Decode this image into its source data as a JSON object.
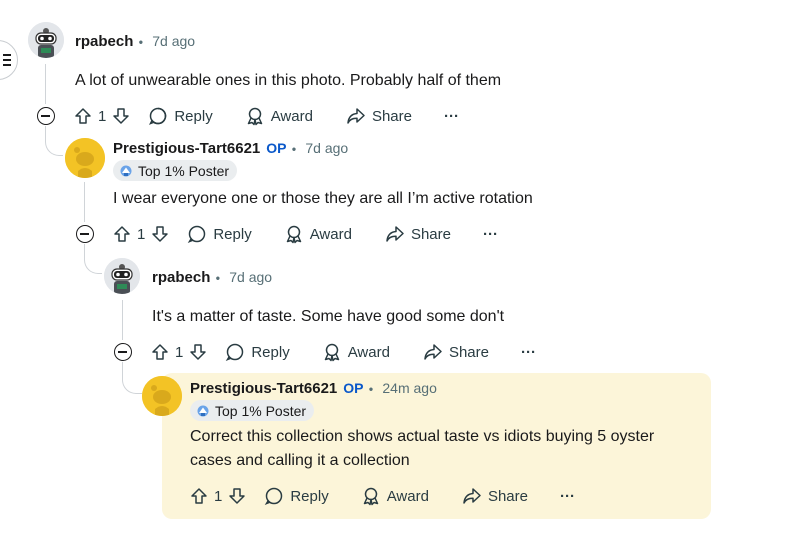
{
  "comments": [
    {
      "username": "rpabech",
      "time": "7d ago",
      "text": "A lot of unwearable ones in this photo. Probably half of them",
      "votes": "1",
      "reply": "Reply",
      "award": "Award",
      "share": "Share",
      "more": "···"
    },
    {
      "username": "Prestigious-Tart6621",
      "op": "OP",
      "time": "7d ago",
      "flair": "Top 1% Poster",
      "text": "I wear everyone one or those they are all I’m active rotation",
      "votes": "1",
      "reply": "Reply",
      "award": "Award",
      "share": "Share",
      "more": "···"
    },
    {
      "username": "rpabech",
      "time": "7d ago",
      "text": "It's a matter of taste. Some have good some don't",
      "votes": "1",
      "reply": "Reply",
      "award": "Award",
      "share": "Share",
      "more": "···"
    },
    {
      "username": "Prestigious-Tart6621",
      "op": "OP",
      "time": "24m ago",
      "flair": "Top 1% Poster",
      "text_line1": "Correct this collection shows actual taste vs idiots buying 5 oyster",
      "text_line2": "cases and calling it a collection",
      "votes": "1",
      "reply": "Reply",
      "award": "Award",
      "share": "Share",
      "more": "···"
    }
  ],
  "colors": {
    "op": "#0a58ca",
    "highlight": "#fcf5d9",
    "flair_bg": "#eaedef",
    "meta": "#576f76"
  },
  "icons": [
    "menu-icon",
    "upvote-icon",
    "downvote-icon",
    "reply-bubble-icon",
    "award-icon",
    "share-icon",
    "more-icon",
    "collapse-icon",
    "top-poster-icon"
  ]
}
